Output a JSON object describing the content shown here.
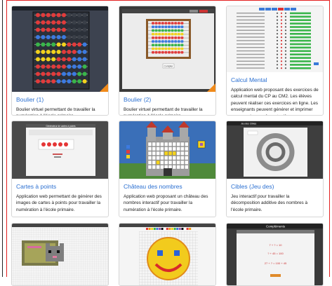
{
  "cards": [
    {
      "title": "Boulier (1)",
      "desc": "Boulier virtuel permettant de travailler la numération à l'école primaire.",
      "thumb_icon": "abacus-dark-thumbnail"
    },
    {
      "title": "Boulier (2)",
      "desc": "Boulier virtuel permettant de travailler la numération à l'école primaire.",
      "thumb_icon": "abacus-light-thumbnail"
    },
    {
      "title": "Calcul Mental",
      "desc": "Application web proposant des exercices de calcul mental du CP au CM2. Les élèves peuvent réaliser ces exercices en ligne. Les enseignants peuvent générer et imprimer ces exercices au format pdf.",
      "thumb_icon": "exercise-list-thumbnail"
    },
    {
      "title": "Cartes à points",
      "desc": "Application web permettant de générer des images de cartes à points pour travailler la numération à l'école primaire.",
      "thumb_icon": "dot-cards-thumbnail"
    },
    {
      "title": "Château des nombres",
      "desc": "Application web proposant un château des nombres interactif pour travailler la numération à l'école primaire.",
      "thumb_icon": "castle-thumbnail"
    },
    {
      "title": "Cibles (Jeu des)",
      "desc": "Jeu interactif pour travailler la décomposition additive des nombres à l'école primaire.",
      "thumb_icon": "target-thumbnail"
    },
    {
      "title": "",
      "desc": "",
      "thumb_icon": "pixel-cat-thumbnail"
    },
    {
      "title": "",
      "desc": "",
      "thumb_icon": "pixel-smiley-thumbnail"
    },
    {
      "title": "",
      "desc": "",
      "thumb_icon": "complements-thumbnail"
    }
  ],
  "thumb_text": {
    "cartes_header": "Générateur de cartes à points",
    "cibles_header": "Jeu des Cibles",
    "complements_header": "Compléments",
    "complement_a": "7 + ? = 10",
    "complement_b": "? + 45 = 100",
    "complement_c": "27 + ? = 100 + 45",
    "abacus_label": "Compter"
  },
  "colors": {
    "accent": "#2a6fd1",
    "frame": "#e32020",
    "corner": "#f08a1a"
  }
}
